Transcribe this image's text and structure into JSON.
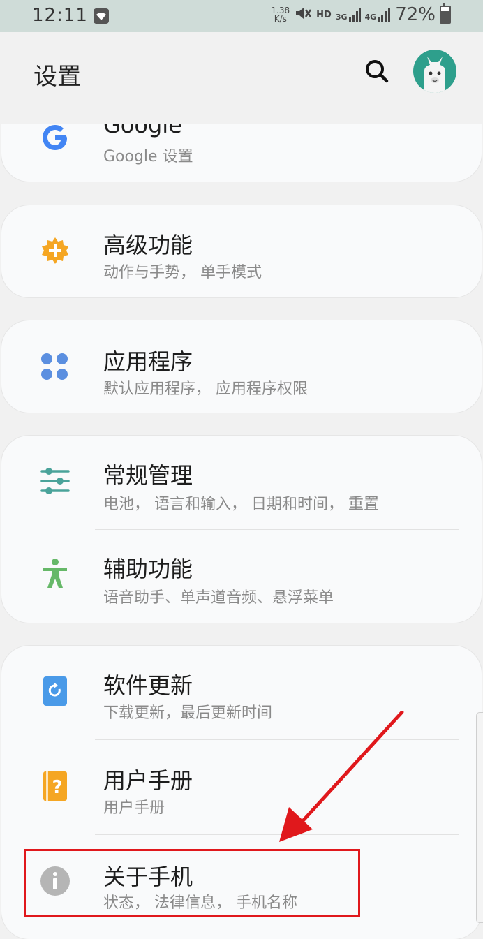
{
  "status_bar": {
    "time": "12:11",
    "net_speed_value": "1.38",
    "net_speed_unit": "K/s",
    "hd": "HD",
    "sim1": "3G",
    "sim2": "4G",
    "battery": "72%"
  },
  "header": {
    "title": "设置"
  },
  "items": [
    {
      "title": "Google",
      "subtitle": "Google  设置",
      "icon": "google-icon"
    },
    {
      "title": "高级功能",
      "subtitle": "动作与手势，  单手模式",
      "icon": "advanced-features-icon"
    },
    {
      "title": "应用程序",
      "subtitle": "默认应用程序，  应用程序权限",
      "icon": "apps-icon"
    },
    {
      "title": "常规管理",
      "subtitle": "电池，  语言和输入，  日期和时间，  重置",
      "icon": "sliders-icon"
    },
    {
      "title": "辅助功能",
      "subtitle": "语音助手、单声道音频、悬浮菜单",
      "icon": "accessibility-icon"
    },
    {
      "title": "软件更新",
      "subtitle": "下载更新，最后更新时间",
      "icon": "software-update-icon"
    },
    {
      "title": "用户手册",
      "subtitle": "用户手册",
      "icon": "user-manual-icon"
    },
    {
      "title": "关于手机",
      "subtitle": "状态，  法律信息，  手机名称",
      "icon": "info-icon"
    }
  ],
  "colors": {
    "accent_red": "#e0181c",
    "google_blue": "#4285f4",
    "advanced_orange": "#f5a623",
    "apps_blue": "#5b8fe0",
    "general_teal": "#4aa39a",
    "accessibility_green": "#66b868",
    "info_gray": "#b5b5b5"
  }
}
